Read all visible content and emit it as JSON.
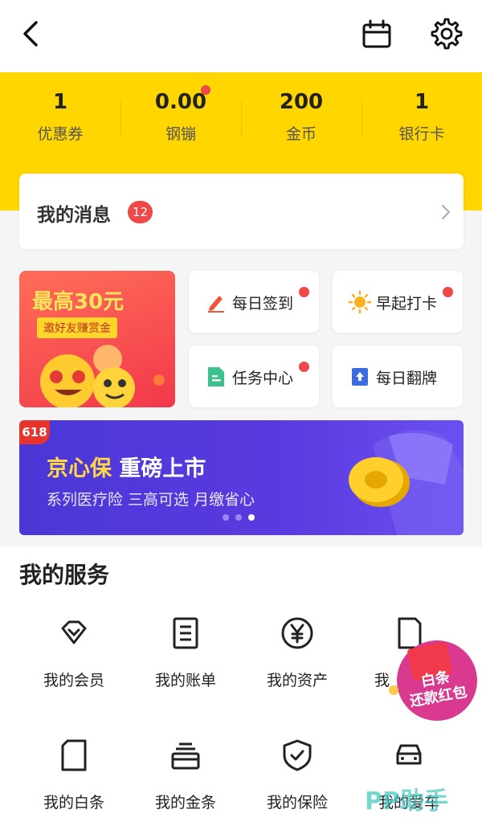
{
  "header": {
    "back_icon": "chevron-left-icon",
    "calendar_icon": "calendar-icon",
    "settings_icon": "gear-icon"
  },
  "stats": [
    {
      "value": "1",
      "label": "优惠券"
    },
    {
      "value": "0.00",
      "label": "钢镚",
      "has_dot": true
    },
    {
      "value": "200",
      "label": "金币"
    },
    {
      "value": "1",
      "label": "银行卡"
    }
  ],
  "messages": {
    "title": "我的消息",
    "badge": "12"
  },
  "promo": {
    "title": "最高30元",
    "tag": "邀好友赚赏金"
  },
  "tiles": [
    {
      "label": "每日签到",
      "icon": "pencil-icon",
      "dot": true
    },
    {
      "label": "早起打卡",
      "icon": "sun-icon",
      "dot": true
    },
    {
      "label": "任务中心",
      "icon": "document-icon",
      "dot": true
    },
    {
      "label": "每日翻牌",
      "icon": "card-flip-icon",
      "dot": false
    }
  ],
  "banner": {
    "tag": "618",
    "title_accent": "京心保",
    "title_rest": " 重磅上市",
    "subtitle": "系列医疗险 三高可选 月缴省心",
    "active_dot": 3,
    "dot_count": 3
  },
  "services": {
    "title": "我的服务",
    "items": [
      {
        "label": "我的会员",
        "icon": "diamond-icon"
      },
      {
        "label": "我的账单",
        "icon": "bill-icon"
      },
      {
        "label": "我的资产",
        "icon": "yen-icon"
      },
      {
        "label": "我",
        "icon": "card-icon"
      },
      {
        "label": "我的白条",
        "icon": "white-card-icon"
      },
      {
        "label": "我的金条",
        "icon": "gold-bar-icon"
      },
      {
        "label": "我的保险",
        "icon": "shield-icon"
      },
      {
        "label": "我的爱车",
        "icon": "car-icon"
      }
    ]
  },
  "float_badge": {
    "line1": "白条",
    "line2": "还款红包"
  },
  "watermark": "PP助手",
  "colors": {
    "brand_yellow": "#ffd600",
    "red_dot": "#f04848",
    "banner_purple": "#5b3ae0"
  }
}
